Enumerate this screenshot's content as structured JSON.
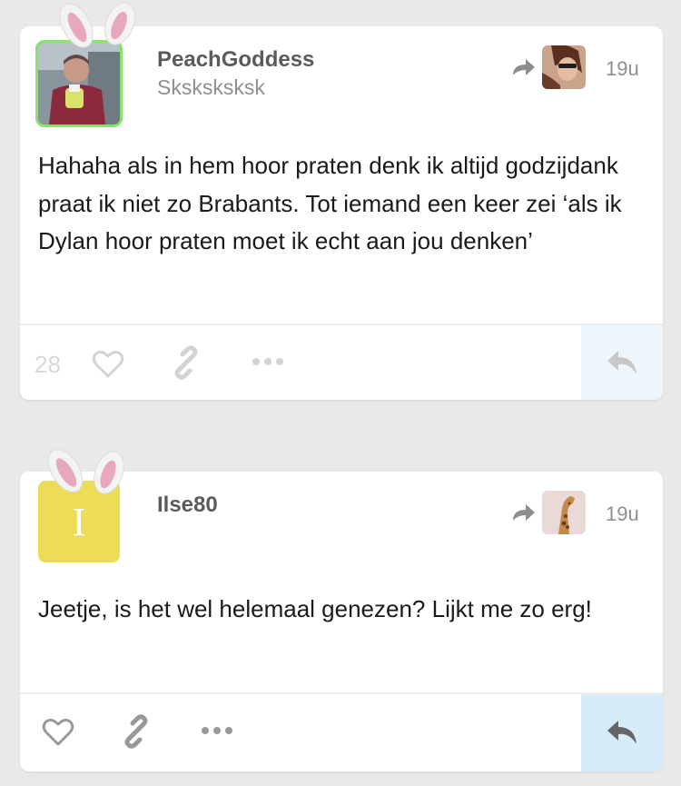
{
  "posts": [
    {
      "username": "PeachGoddess",
      "subtitle": "Sksksksksk",
      "timestamp": "19u",
      "body": "Hahaha als in hem hoor praten denk ik altijd godzijdank praat ik niet zo Brabants. Tot iemand een keer zei ‘als ik Dylan hoor praten moet ik echt aan jou denken’",
      "note_count": "28",
      "avatar_border_color": "#86e36b"
    },
    {
      "username": "Ilse80",
      "avatar_letter": "I",
      "timestamp": "19u",
      "body": "Jeetje, is het wel helemaal genezen? Lijkt me zo erg!",
      "avatar_color": "#eddc55"
    }
  ],
  "icons": [
    "bunny-ears-icon",
    "reblog-icon",
    "heart-icon",
    "link-icon",
    "more-icon",
    "reply-icon"
  ]
}
